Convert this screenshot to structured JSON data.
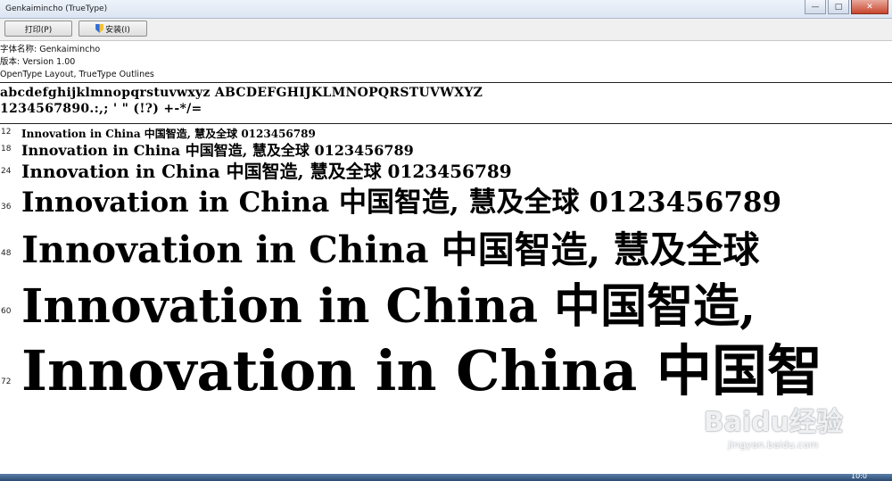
{
  "window": {
    "title": "Genkaimincho (TrueType)",
    "controls": [
      "minimize-icon",
      "maximize-icon",
      "close-icon"
    ]
  },
  "toolbar": {
    "print_label": "打印(P)",
    "install_label": "安装(I)"
  },
  "font_info": {
    "name_line": "字体名称: Genkaimincho",
    "version_line": "版本: Version 1.00",
    "type_line": "OpenType Layout, TrueType Outlines"
  },
  "charset": {
    "line1": "abcdefghijklmnopqrstuvwxyz ABCDEFGHIJKLMNOPQRSTUVWXYZ",
    "line2": "1234567890.:,; ' \" (!?) +-*/="
  },
  "samples": [
    {
      "size": "12",
      "text": "Innovation in China 中国智造, 慧及全球 0123456789"
    },
    {
      "size": "18",
      "text": "Innovation in China 中国智造, 慧及全球 0123456789"
    },
    {
      "size": "24",
      "text": "Innovation in China 中国智造, 慧及全球 0123456789"
    },
    {
      "size": "36",
      "text": "Innovation in China 中国智造, 慧及全球 0123456789"
    },
    {
      "size": "48",
      "text": "Innovation in China 中国智造, 慧及全球"
    },
    {
      "size": "60",
      "text": "Innovation in China 中国智造,"
    },
    {
      "size": "72",
      "text": "Innovation in China 中国智"
    }
  ],
  "watermark": {
    "logo": "Baidu经验",
    "url": "jingyan.baidu.com"
  },
  "taskbar": {
    "clock": "10:0"
  }
}
